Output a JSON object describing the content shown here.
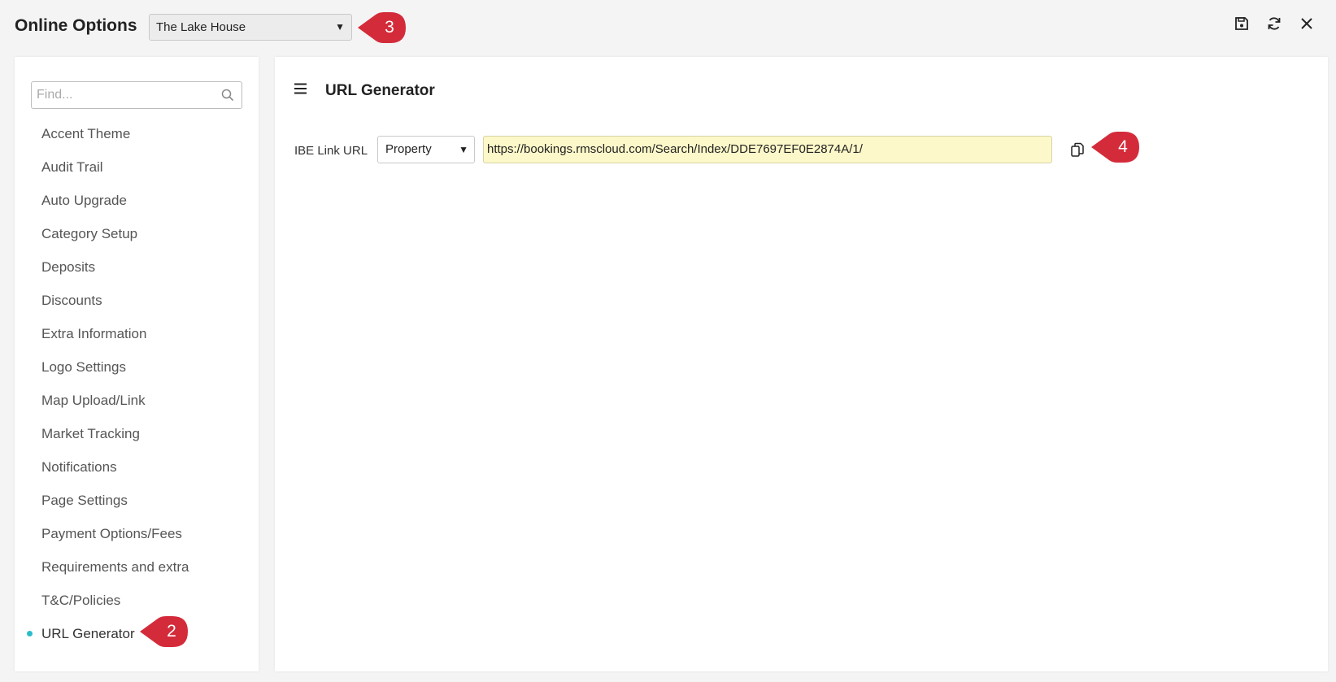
{
  "header": {
    "title": "Online Options",
    "property_select": "The Lake House",
    "icons": [
      "save-icon",
      "refresh-icon",
      "close-icon"
    ]
  },
  "callouts": {
    "sidebar": "2",
    "property": "3",
    "copy": "4"
  },
  "sidebar": {
    "search_placeholder": "Find...",
    "items": [
      {
        "label": "Accent Theme"
      },
      {
        "label": "Audit Trail"
      },
      {
        "label": "Auto Upgrade"
      },
      {
        "label": "Category Setup"
      },
      {
        "label": "Deposits"
      },
      {
        "label": "Discounts"
      },
      {
        "label": "Extra Information"
      },
      {
        "label": "Logo Settings"
      },
      {
        "label": "Map Upload/Link"
      },
      {
        "label": "Market Tracking"
      },
      {
        "label": "Notifications"
      },
      {
        "label": "Page Settings"
      },
      {
        "label": "Payment Options/Fees"
      },
      {
        "label": "Requirements and extra"
      },
      {
        "label": "T&C/Policies"
      },
      {
        "label": "URL Generator",
        "active": true
      }
    ]
  },
  "main": {
    "title": "URL Generator",
    "ibe_label": "IBE Link URL",
    "type_select": "Property",
    "url_value": "https://bookings.rmscloud.com/Search/Index/DDE7697EF0E2874A/1/"
  },
  "colors": {
    "callout": "#d42b3a",
    "active_dot": "#2bbccb",
    "url_bg": "#fdf8c9"
  }
}
